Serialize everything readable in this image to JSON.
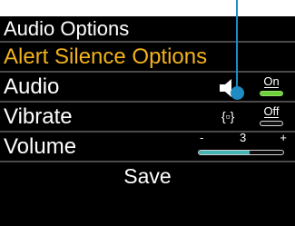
{
  "header": {
    "title": "Audio Options"
  },
  "menu": {
    "alert_silence": "Alert Silence Options",
    "audio": {
      "label": "Audio",
      "icon": "speaker-icon",
      "toggle": "On"
    },
    "vibrate": {
      "label": "Vibrate",
      "icon": "vibrate-icon",
      "glyph": "{▫}",
      "toggle": "Off"
    },
    "volume": {
      "label": "Volume",
      "min": "-",
      "max": "+",
      "value": "3",
      "level": 0.6
    },
    "save": "Save"
  },
  "colors": {
    "selected": "#f2b21c",
    "on": "#6fd13a",
    "volume_fill": "#43b3b3",
    "pointer": "#1e8bc3"
  }
}
